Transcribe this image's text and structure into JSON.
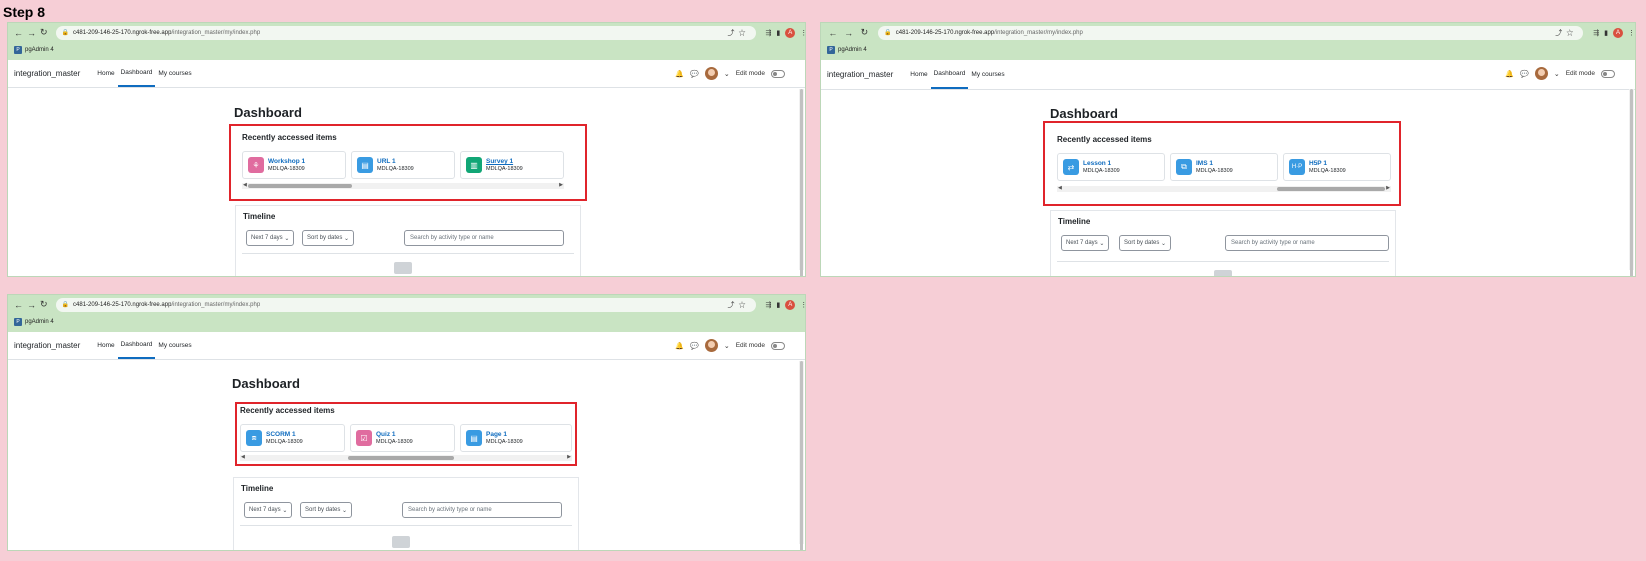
{
  "step_title": "Step 8",
  "browser": {
    "url_host": "c481-209-146-25-170.ngrok-free.app",
    "url_path": "/integration_master/my/index.php",
    "bookmark": "pgAdmin 4",
    "profile_initial": "A"
  },
  "site": {
    "brand": "integration_master",
    "menu": [
      "Home",
      "Dashboard",
      "My courses"
    ],
    "edit_mode": "Edit mode"
  },
  "dashboard": {
    "title": "Dashboard",
    "recent_title": "Recently accessed items",
    "timeline_title": "Timeline",
    "filter_days": "Next 7 days",
    "sort": "Sort by dates",
    "search_placeholder": "Search by activity type or name"
  },
  "screens": [
    {
      "items": [
        {
          "name": "Workshop 1",
          "course": "MDLQA-18309",
          "icon": "workshop-icon",
          "color": "#e06c9f"
        },
        {
          "name": "URL 1",
          "course": "MDLQA-18309",
          "icon": "url-icon",
          "color": "#399be2"
        },
        {
          "name": "Survey 1",
          "course": "MDLQA-18309",
          "icon": "survey-icon",
          "color": "#11a676"
        }
      ],
      "scroll_position": 0.0
    },
    {
      "items": [
        {
          "name": "Lesson 1",
          "course": "MDLQA-18309",
          "icon": "lesson-icon",
          "color": "#399be2"
        },
        {
          "name": "IMS 1",
          "course": "MDLQA-18309",
          "icon": "ims-icon",
          "color": "#399be2"
        },
        {
          "name": "H5P 1",
          "course": "MDLQA-18309",
          "icon": "h5p-icon",
          "color": "#399be2"
        }
      ],
      "scroll_position": 1.0
    },
    {
      "items": [
        {
          "name": "SCORM 1",
          "course": "MDLQA-18309",
          "icon": "scorm-icon",
          "color": "#399be2"
        },
        {
          "name": "Quiz 1",
          "course": "MDLQA-18309",
          "icon": "quiz-icon",
          "color": "#e06c9f"
        },
        {
          "name": "Page 1",
          "course": "MDLQA-18309",
          "icon": "page-icon",
          "color": "#399be2"
        }
      ],
      "scroll_position": 0.5
    }
  ]
}
